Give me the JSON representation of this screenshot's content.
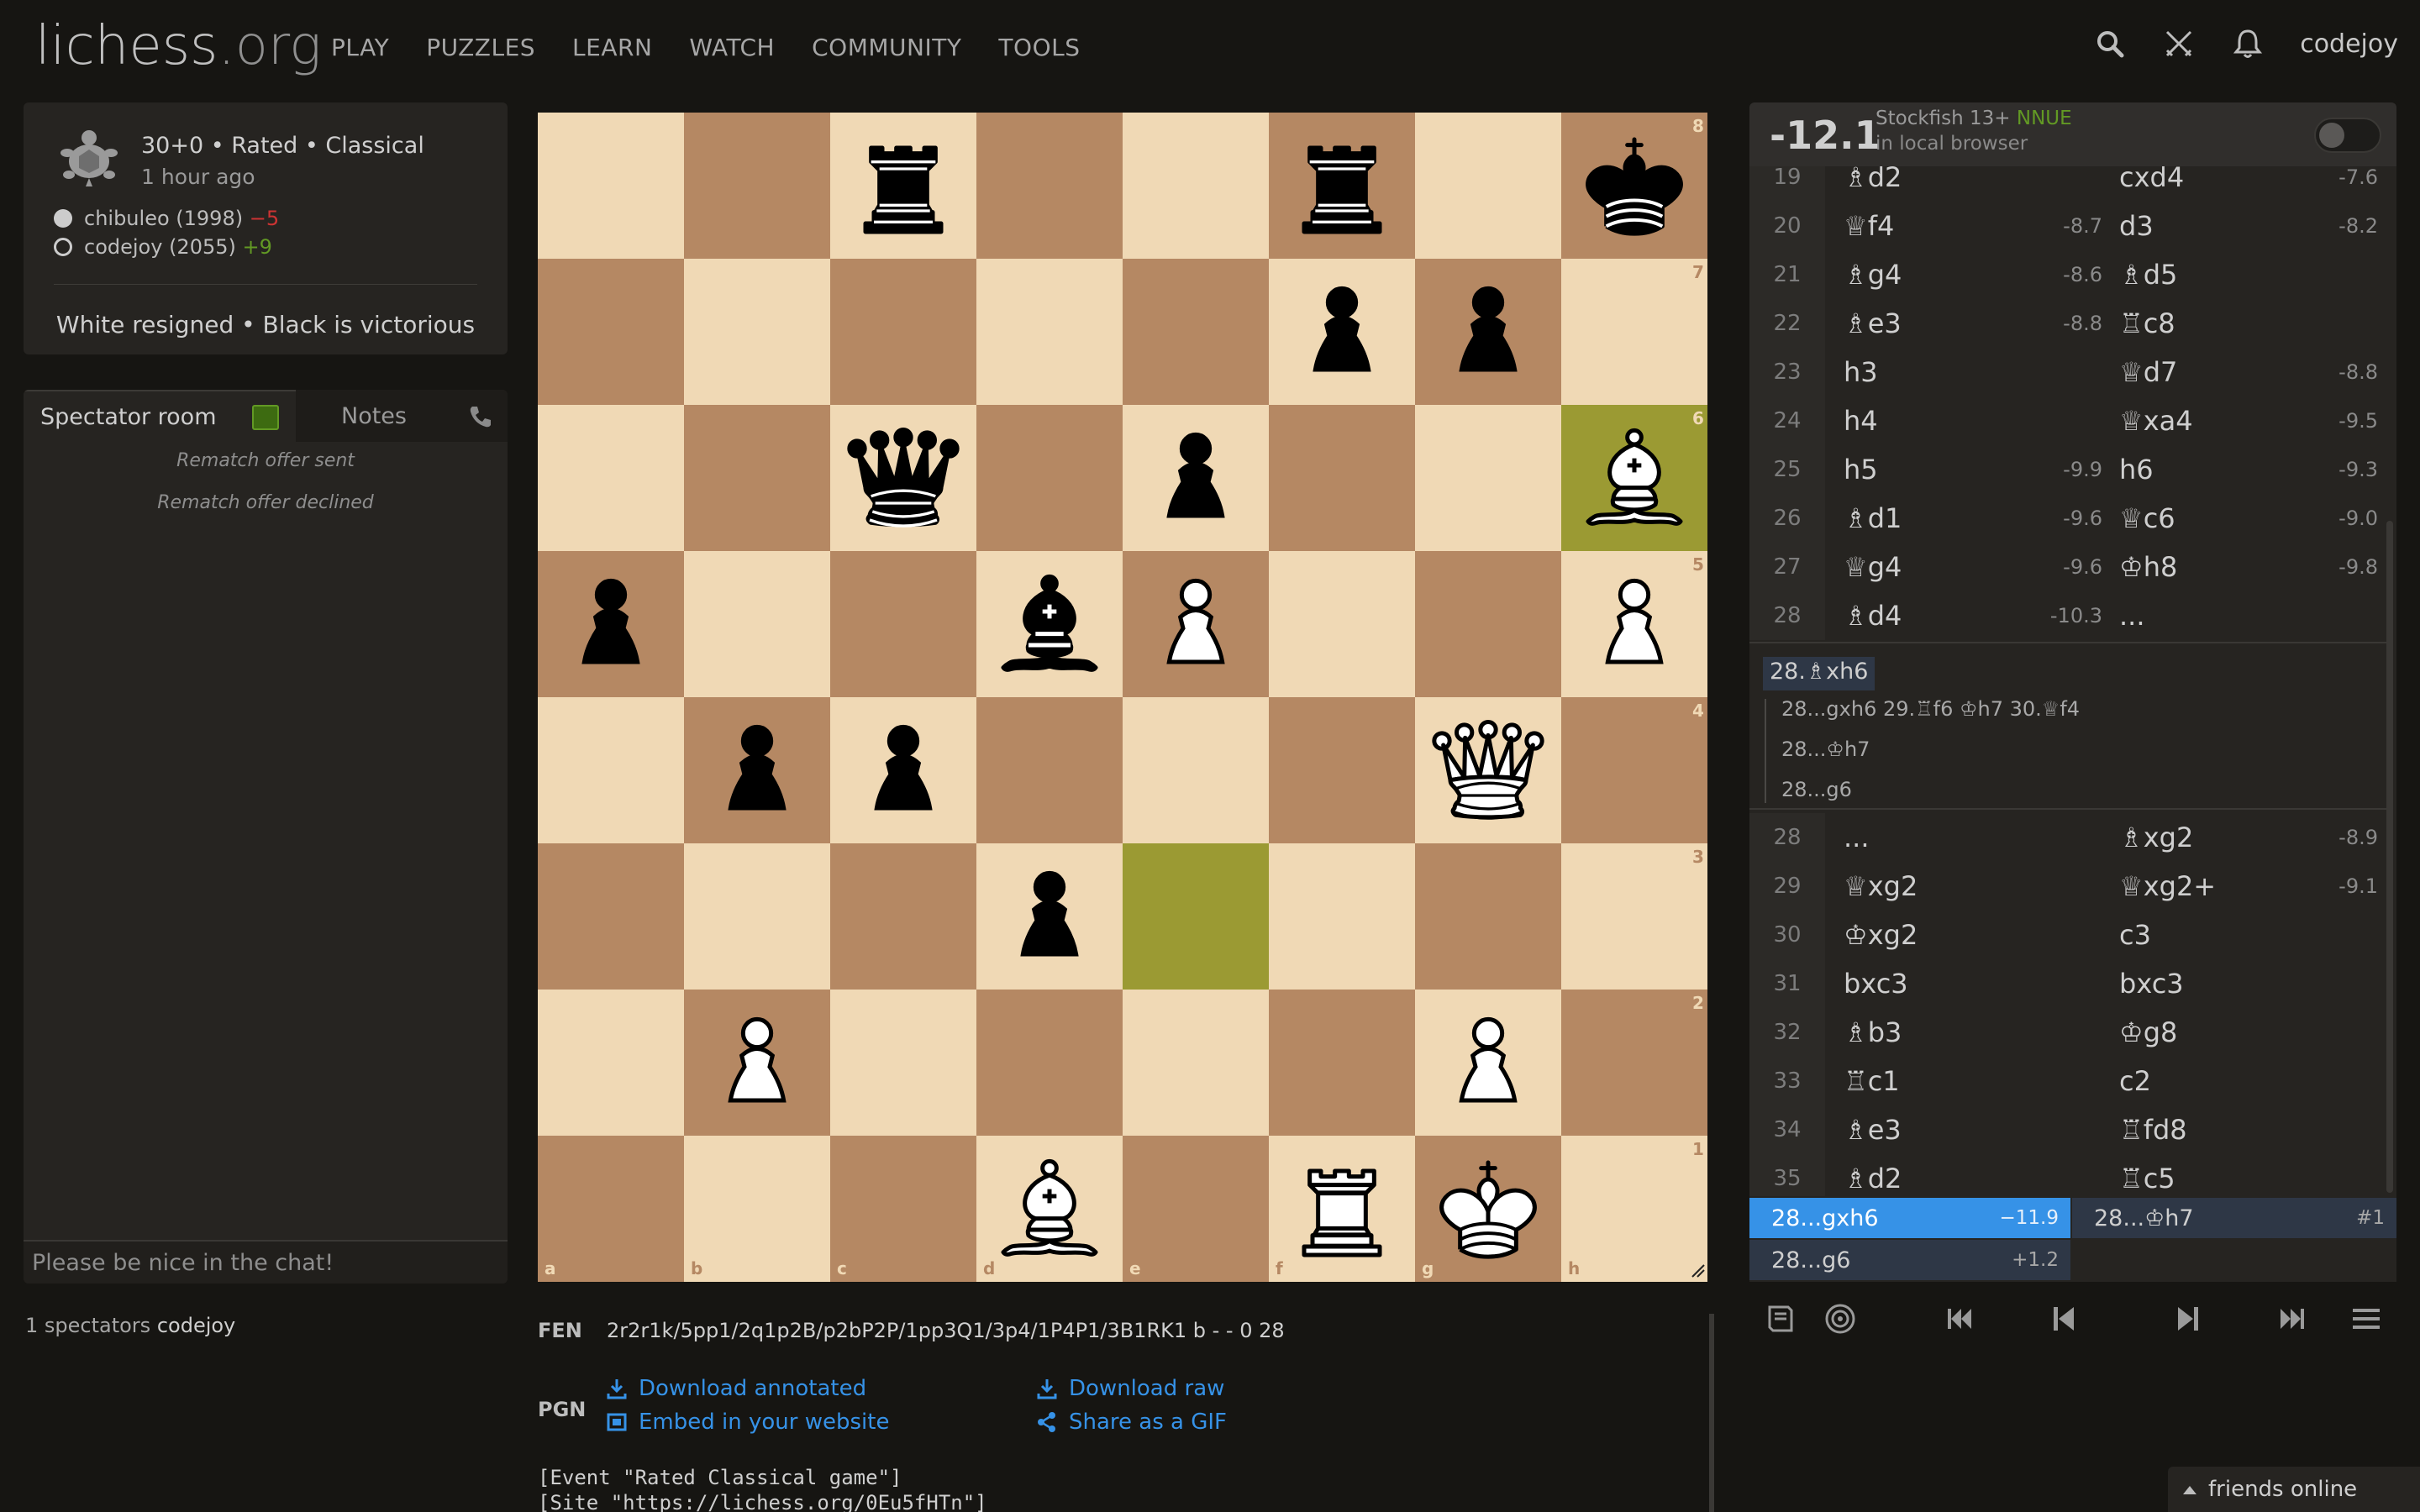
{
  "header": {
    "logo_main": "lichess",
    "logo_tld": ".org",
    "nav": [
      "PLAY",
      "PUZZLES",
      "LEARN",
      "WATCH",
      "COMMUNITY",
      "TOOLS"
    ],
    "user": "codejoy",
    "icons": [
      "search-icon",
      "swords-icon",
      "bell-icon"
    ]
  },
  "game": {
    "mode": "30+0 • Rated • Classical",
    "time": "1 hour ago",
    "white": {
      "name": "chibuleo (1998)",
      "diff": "−5"
    },
    "black": {
      "name": "codejoy (2055)",
      "diff": "+9"
    },
    "result": "White resigned • Black is victorious"
  },
  "chat": {
    "tab_chat": "Spectator room",
    "tab_notes": "Notes",
    "messages": [
      "Rematch offer sent",
      "Rematch offer declined"
    ],
    "placeholder": "Please be nice in the chat!"
  },
  "spectators": {
    "count_text": "1 spectators",
    "user": "codejoy"
  },
  "board": {
    "files": [
      "a",
      "b",
      "c",
      "d",
      "e",
      "f",
      "g",
      "h"
    ],
    "ranks": [
      "8",
      "7",
      "6",
      "5",
      "4",
      "3",
      "2",
      "1"
    ],
    "fen_position": "2r2r1k/5pp1/2q1p2B/p2bP2P/1pp3Q1/3p4/1P4P1/3B1RK1",
    "highlights": [
      "h6",
      "e3"
    ],
    "light_color": "#f0d9b5",
    "dark_color": "#b58863",
    "highlight_color": "#9b9a33"
  },
  "under_board": {
    "fen_label": "FEN",
    "fen": "2r2r1k/5pp1/2q1p2B/p2bP2P/1pp3Q1/3p4/1P4P1/3B1RK1 b - - 0 28",
    "pgn_label": "PGN",
    "download_annotated": "Download annotated",
    "download_raw": "Download raw",
    "embed": "Embed in your website",
    "gif": "Share as a GIF",
    "pgn_lines": [
      "[Event \"Rated Classical game\"]",
      "[Site \"https://lichess.org/0Eu5fHTn\"]"
    ]
  },
  "ceval": {
    "score": "-12.1",
    "engine": "Stockfish 13+",
    "nnue": "NNUE",
    "sub": "in local browser"
  },
  "moves_top": [
    {
      "n": "19",
      "w": "♗d2",
      "we": "",
      "b": "cxd4",
      "be": "-7.6"
    },
    {
      "n": "20",
      "w": "♕f4",
      "we": "-8.7",
      "b": "d3",
      "be": "-8.2"
    },
    {
      "n": "21",
      "w": "♗g4",
      "we": "-8.6",
      "b": "♗d5",
      "be": ""
    },
    {
      "n": "22",
      "w": "♗e3",
      "we": "-8.8",
      "b": "♖c8",
      "be": ""
    },
    {
      "n": "23",
      "w": "h3",
      "we": "",
      "b": "♕d7",
      "be": "-8.8"
    },
    {
      "n": "24",
      "w": "h4",
      "we": "",
      "b": "♕xa4",
      "be": "-9.5"
    },
    {
      "n": "25",
      "w": "h5",
      "we": "-9.9",
      "b": "h6",
      "be": "-9.3"
    },
    {
      "n": "26",
      "w": "♗d1",
      "we": "-9.6",
      "b": "♕c6",
      "be": "-9.0"
    },
    {
      "n": "27",
      "w": "♕g4",
      "we": "-9.6",
      "b": "♔h8",
      "be": "-9.8"
    },
    {
      "n": "28",
      "w": "♗d4",
      "we": "-10.3",
      "b": "...",
      "be": ""
    }
  ],
  "variations": {
    "main": "28.♗xh6",
    "sub": [
      "28...gxh6 29.♖f6 ♔h7 30.♕f4",
      "28...♔h7",
      "28...g6"
    ]
  },
  "moves_bottom": [
    {
      "n": "28",
      "w": "...",
      "we": "",
      "b": "♗xg2",
      "be": "-8.9"
    },
    {
      "n": "29",
      "w": "♕xg2",
      "we": "",
      "b": "♕xg2+",
      "be": "-9.1"
    },
    {
      "n": "30",
      "w": "♔xg2",
      "we": "",
      "b": "c3",
      "be": ""
    },
    {
      "n": "31",
      "w": "bxc3",
      "we": "",
      "b": "bxc3",
      "be": ""
    },
    {
      "n": "32",
      "w": "♗b3",
      "we": "",
      "b": "♔g8",
      "be": ""
    },
    {
      "n": "33",
      "w": "♖c1",
      "we": "",
      "b": "c2",
      "be": ""
    },
    {
      "n": "34",
      "w": "♗e3",
      "we": "",
      "b": "♖fd8",
      "be": ""
    },
    {
      "n": "35",
      "w": "♗d2",
      "we": "",
      "b": "♖c5",
      "be": ""
    }
  ],
  "pvs": [
    {
      "move": "28...gxh6",
      "eval": "−11.9"
    },
    {
      "move": "28...♔h7",
      "eval": "#1"
    },
    {
      "move": "28...g6",
      "eval": "+1.2"
    }
  ],
  "friends": "friends online",
  "colors": {
    "accent_blue": "#3692e7",
    "positive": "#629924",
    "negative": "#cc3333",
    "background": "#161512"
  }
}
